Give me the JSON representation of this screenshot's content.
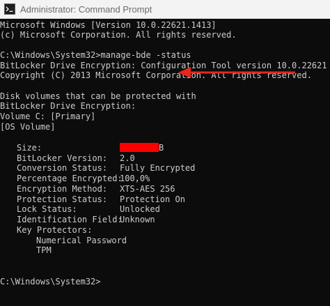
{
  "window": {
    "title": "Administrator: Command Prompt",
    "icon": "cmd-icon"
  },
  "console": {
    "header": [
      "Microsoft Windows [Version 10.0.22621.1413]",
      "(c) Microsoft Corporation. All rights reserved."
    ],
    "command_line": "C:\\Windows\\System32>manage-bde -status",
    "tool_lines": [
      "BitLocker Drive Encryption: Configuration Tool version 10.0.22621",
      "Copyright (C) 2013 Microsoft Corporation. All rights reserved."
    ],
    "volume_lines": [
      "Disk volumes that can be protected with",
      "BitLocker Drive Encryption:",
      "Volume C: [Primary]",
      "[OS Volume]"
    ],
    "fields": [
      {
        "label": "Size:",
        "value": ""
      },
      {
        "label": "BitLocker Version:",
        "value": "2.0"
      },
      {
        "label": "Conversion Status:",
        "value": "Fully Encrypted"
      },
      {
        "label": "Percentage Encrypted:",
        "value": "100,0%"
      },
      {
        "label": "Encryption Method:",
        "value": "XTS-AES 256"
      },
      {
        "label": "Protection Status:",
        "value": "Protection On"
      },
      {
        "label": "Lock Status:",
        "value": "Unlocked"
      },
      {
        "label": "Identification Field:",
        "value": "Unknown"
      },
      {
        "label": "Key Protectors:",
        "value": ""
      }
    ],
    "size_tail": "B",
    "key_protectors": [
      "Numerical Password",
      "TPM"
    ],
    "final_prompt": "C:\\Windows\\System32>"
  },
  "annotation": {
    "arrow_color": "#e8261c",
    "redaction_color": "#ff0000"
  }
}
